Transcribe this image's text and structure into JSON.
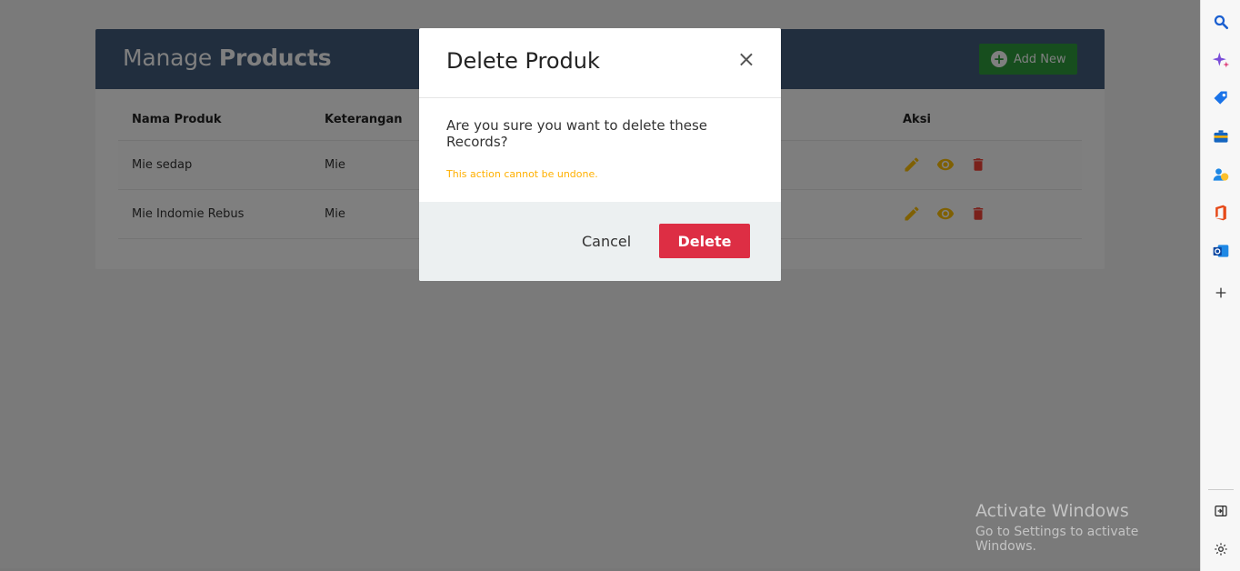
{
  "card": {
    "title_prefix": "Manage ",
    "title_bold": "Products",
    "add_label": "Add New"
  },
  "table": {
    "headers": [
      "Nama Produk",
      "Keterangan",
      "Aksi"
    ],
    "rows": [
      {
        "nama": "Mie sedap",
        "keterangan": "Mie"
      },
      {
        "nama": "Mie Indomie Rebus",
        "keterangan": "Mie"
      }
    ]
  },
  "modal": {
    "title": "Delete Produk",
    "close": "×",
    "message": "Are you sure you want to delete these Records?",
    "warning": "This action cannot be undone.",
    "cancel_label": "Cancel",
    "delete_label": "Delete"
  },
  "watermark": {
    "line1": "Activate Windows",
    "line2": "Go to Settings to activate Windows."
  },
  "colors": {
    "header_bg": "#435d7d",
    "add_btn": "#2e9c3c",
    "delete_btn": "#dd2e44",
    "warning": "#ffb000",
    "edit_icon": "#ffc107",
    "delete_icon": "#f44336"
  },
  "sidebar": {
    "icons": [
      "search-icon",
      "copilot-sparkle-icon",
      "shopping-tag-icon",
      "tools-briefcase-icon",
      "people-games-icon",
      "office-icon",
      "outlook-icon",
      "add-icon",
      "sidebar-toggle-icon",
      "settings-icon"
    ]
  }
}
